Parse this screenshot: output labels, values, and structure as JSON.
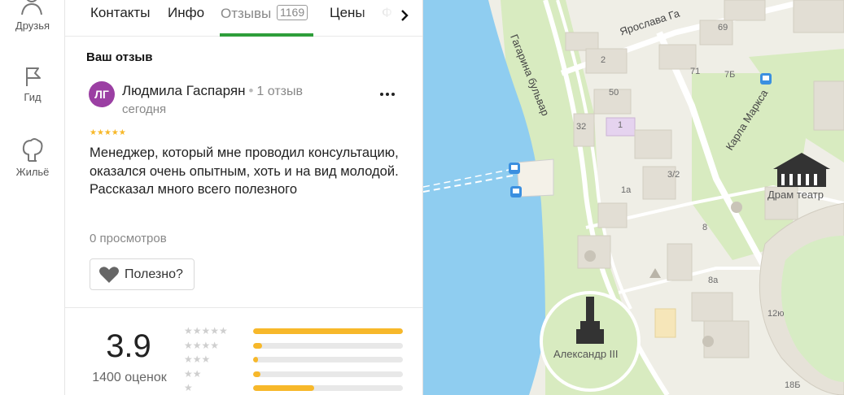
{
  "rail": {
    "friends": "Друзья",
    "guide": "Гид",
    "housing": "Жильё"
  },
  "tabs": {
    "contacts": "Контакты",
    "info": "Инфо",
    "reviews": "Отзывы",
    "reviews_count": "1169",
    "prices": "Цены",
    "more": "Ф"
  },
  "review": {
    "section_title": "Ваш отзыв",
    "avatar_initials": "ЛГ",
    "author": "Людмила Гаспарян",
    "author_reviews": "1 отзыв",
    "date": "сегодня",
    "stars": "★★★★★",
    "text": "Менеджер, который мне проводил консультацию, оказался очень опытным, хоть и на вид молодой. Рассказал много всего полезного",
    "views": "0 просмотров",
    "useful_label": "Полезно?"
  },
  "rating": {
    "value": "3.9",
    "count": "1400 оценок",
    "distribution": [
      {
        "stars": "★★★★★",
        "fraction": 1.0
      },
      {
        "stars": "★★★★",
        "fraction": 0.06
      },
      {
        "stars": "★★★",
        "fraction": 0.03
      },
      {
        "stars": "★★",
        "fraction": 0.05
      },
      {
        "stars": "★",
        "fraction": 0.41
      }
    ]
  },
  "map": {
    "colors": {
      "water": "#8fcdf0",
      "park": "#d8ebc0",
      "land": "#efeee6",
      "road": "#ffffff",
      "building": "#e2ded4"
    },
    "streets": {
      "gagarina": "Гагарина бульвар",
      "yaroslava": "Ярослава Га",
      "karla_marksa": "Карла Маркса"
    },
    "pois": {
      "theatre": "Драм театр",
      "monument": "Александр III"
    },
    "house_numbers": {
      "n2": "2",
      "n71": "71",
      "n69": "69",
      "n7b": "7Б",
      "n50": "50",
      "n32": "32",
      "n1": "1",
      "n3_2": "3/2",
      "n1a": "1а",
      "n8": "8",
      "n8a": "8а",
      "n12yu": "12ю",
      "n18b": "18Б"
    }
  }
}
